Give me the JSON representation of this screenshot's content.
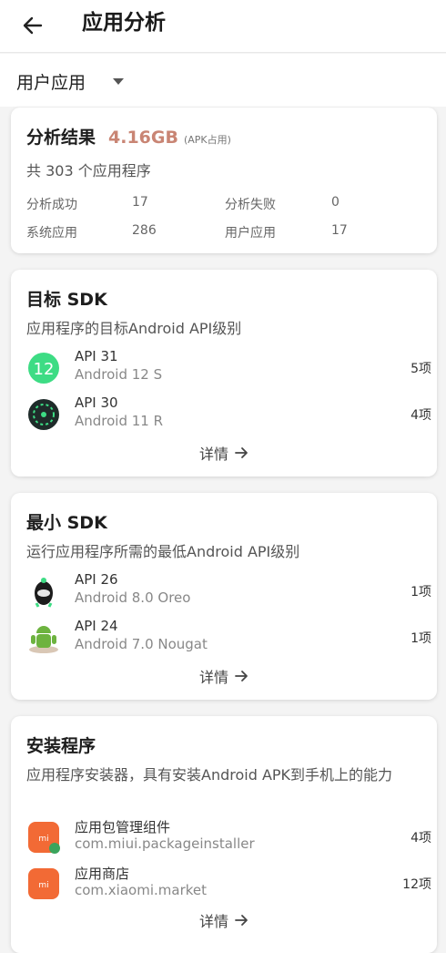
{
  "header": {
    "title": "应用分析",
    "back_icon": "arrow-left-icon"
  },
  "filter": {
    "selected": "用户应用",
    "caret_icon": "caret-down-icon"
  },
  "summary": {
    "title": "分析结果",
    "size": "4.16GB",
    "size_note": "(APK占用)",
    "count_text": "共 303 个应用程序",
    "stats": [
      {
        "label": "分析成功",
        "value": "17"
      },
      {
        "label": "分析失败",
        "value": "0"
      },
      {
        "label": "系统应用",
        "value": "286"
      },
      {
        "label": "用户应用",
        "value": "17"
      }
    ]
  },
  "target_sdk": {
    "title": "目标 SDK",
    "desc": "应用程序的目标Android API级别",
    "items": [
      {
        "name": "API 31",
        "sub": "Android 12 S",
        "count": "5项",
        "icon": "android-12-icon"
      },
      {
        "name": "API 30",
        "sub": "Android 11 R",
        "count": "4项",
        "icon": "android-11-icon"
      }
    ],
    "details": "详情"
  },
  "min_sdk": {
    "title": "最小 SDK",
    "desc": "运行应用程序所需的最低Android API级别",
    "items": [
      {
        "name": "API 26",
        "sub": "Android 8.0 Oreo",
        "count": "1项",
        "icon": "android-oreo-icon"
      },
      {
        "name": "API 24",
        "sub": "Android 7.0 Nougat",
        "count": "1项",
        "icon": "android-nougat-icon"
      }
    ],
    "details": "详情"
  },
  "installers": {
    "title": "安装程序",
    "desc": "应用程序安装器，具有安装Android APK到手机上的能力",
    "items": [
      {
        "name": "应用包管理组件",
        "sub": "com.miui.packageinstaller",
        "count": "4项",
        "icon": "mi-package-installer-icon"
      },
      {
        "name": "应用商店",
        "sub": "com.xiaomi.market",
        "count": "12项",
        "icon": "mi-market-icon"
      }
    ],
    "details": "详情"
  },
  "colors": {
    "accent_size": "#c98574",
    "mi_orange": "#f26a35",
    "android_green": "#3ddc84"
  }
}
